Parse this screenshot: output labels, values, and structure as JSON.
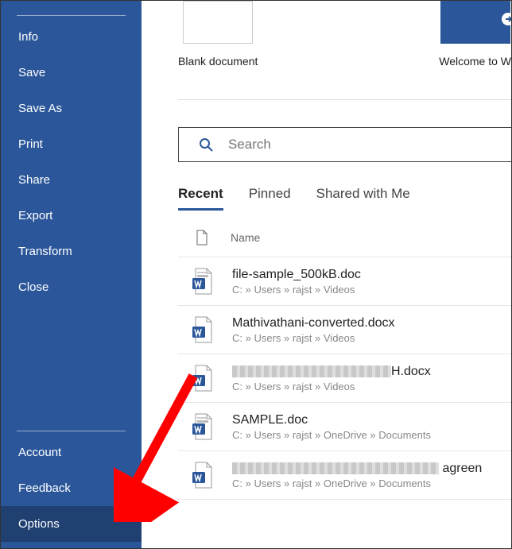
{
  "sidebar": {
    "top_items": [
      {
        "label": "Info"
      },
      {
        "label": "Save"
      },
      {
        "label": "Save As"
      },
      {
        "label": "Print"
      },
      {
        "label": "Share"
      },
      {
        "label": "Export"
      },
      {
        "label": "Transform"
      },
      {
        "label": "Close"
      }
    ],
    "bottom_items": [
      {
        "label": "Account",
        "active": false
      },
      {
        "label": "Feedback",
        "active": false
      },
      {
        "label": "Options",
        "active": true
      }
    ]
  },
  "templates": [
    {
      "label": "Blank document"
    },
    {
      "label": "Welcome to W"
    }
  ],
  "search": {
    "placeholder": "Search"
  },
  "tabs": [
    {
      "label": "Recent",
      "active": true
    },
    {
      "label": "Pinned",
      "active": false
    },
    {
      "label": "Shared with Me",
      "active": false
    }
  ],
  "list_header": {
    "name_label": "Name"
  },
  "files": [
    {
      "name": "file-sample_500kB.doc",
      "path": "C: » Users » rajst » Videos",
      "type": "doc"
    },
    {
      "name": "Mathivathani-converted.docx",
      "path": "C: » Users » rajst » Videos",
      "type": "docx"
    },
    {
      "name_suffix": "H.docx",
      "path": "C: » Users » rajst » Videos",
      "redacted": true,
      "type": "docx"
    },
    {
      "name": "SAMPLE.doc",
      "path": "C: » Users » rajst » OneDrive » Documents",
      "type": "doc"
    },
    {
      "name_suffix": " agreen",
      "path": "C: » Users » rajst » OneDrive » Documents",
      "redacted": true,
      "type": "docx",
      "redact_long": true
    }
  ],
  "colors": {
    "brand": "#2b579a",
    "arrow": "#ff0000"
  }
}
